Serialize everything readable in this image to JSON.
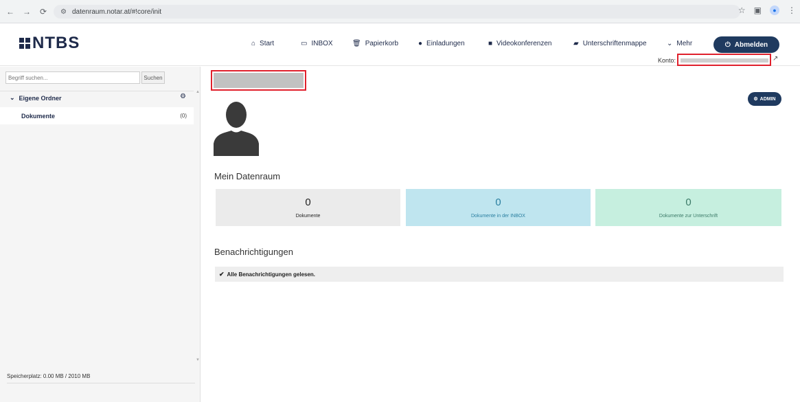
{
  "browser": {
    "url": "datenraum.notar.at/#!core/init",
    "back": "←",
    "forward": "→",
    "reload": "⟳"
  },
  "header": {
    "logo_text": "NTBS",
    "nav": [
      {
        "label": "Start",
        "icon": "home-icon",
        "glyph": "⌂"
      },
      {
        "label": "INBOX",
        "icon": "inbox-icon",
        "glyph": "▭"
      },
      {
        "label": "Papierkorb",
        "icon": "trash-icon",
        "glyph": "🗑"
      },
      {
        "label": "Einladungen",
        "icon": "globe-icon",
        "glyph": "●"
      },
      {
        "label": "Videokonferenzen",
        "icon": "video-icon",
        "glyph": "■"
      },
      {
        "label": "Unterschriftenmappe",
        "icon": "folder-icon",
        "glyph": "▰"
      },
      {
        "label": "Mehr",
        "icon": "chevron-down-icon",
        "glyph": "⌄"
      }
    ],
    "logout_label": "Abmelden",
    "konto_label": "Konto:"
  },
  "sidebar": {
    "search_placeholder": "Begriff suchen...",
    "search_button": "Suchen",
    "folder_group": "Eigene Ordner",
    "folders": [
      {
        "label": "Dokumente",
        "count": "(0)"
      }
    ],
    "storage": "Speicherplatz: 0.00 MB / 2010 MB"
  },
  "main": {
    "admin_label": "ADMIN",
    "datenraum_title": "Mein Datenraum",
    "stats": [
      {
        "value": "0",
        "label": "Dokumente",
        "color": "#ebebeb"
      },
      {
        "value": "0",
        "label": "Dokumente in der INBOX",
        "color": "#bfe5ef"
      },
      {
        "value": "0",
        "label": "Dokumente zur Unterschrift",
        "color": "#c6efdf"
      }
    ],
    "notifications_title": "Benachrichtigungen",
    "notifications_text": "Alle Benachrichtigungen gelesen."
  },
  "colors": {
    "accent": "#1f3a5f",
    "redaction_border": "#e0202c"
  }
}
